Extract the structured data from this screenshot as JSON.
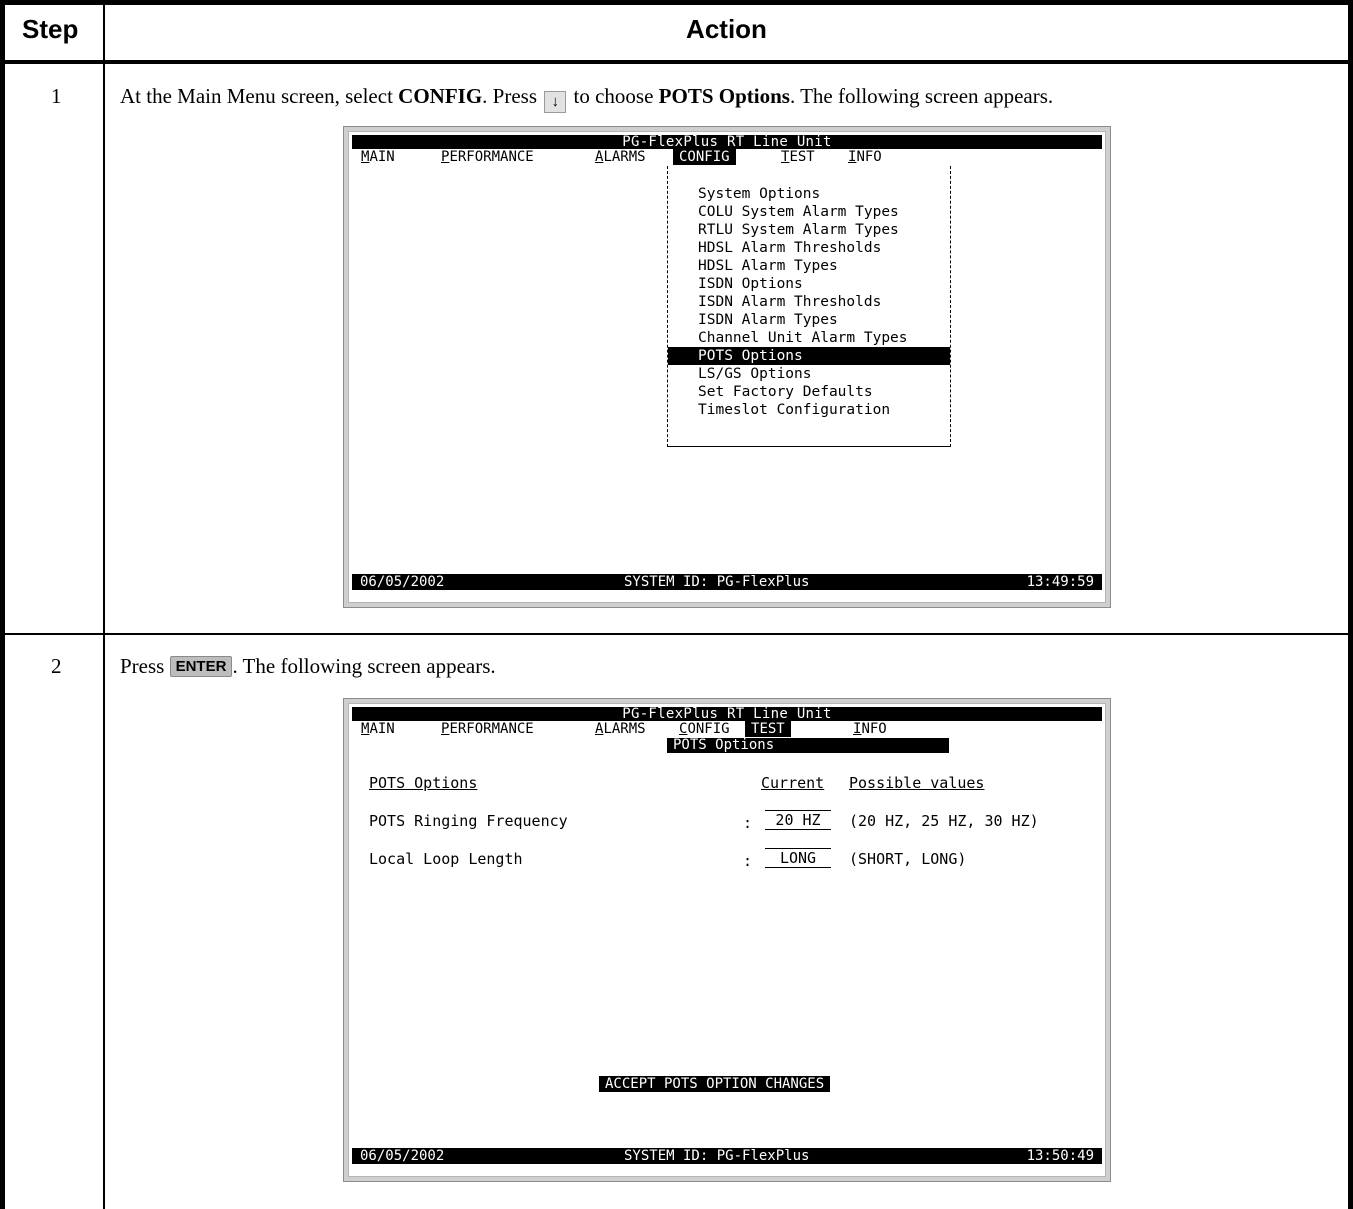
{
  "header": {
    "step": "Step",
    "action": "Action"
  },
  "steps": [
    {
      "number": "1",
      "instruction": {
        "p1": "At the Main Menu screen, select ",
        "b1": "CONFIG",
        "p2": ". Press ",
        "key": "↓",
        "p3": " to choose ",
        "b2": "POTS Options",
        "p4": ". The following screen appears."
      }
    },
    {
      "number": "2",
      "instruction": {
        "p1": "Press ",
        "key": "ENTER",
        "p2": ". The following screen appears."
      }
    }
  ],
  "screen1": {
    "title": "PG-FlexPlus RT Line Unit",
    "menu": [
      {
        "hot": "M",
        "rest": "AIN"
      },
      {
        "hot": "P",
        "rest": "ERFORMANCE"
      },
      {
        "hot": "A",
        "rest": "LARMS"
      },
      {
        "hot": "",
        "rest": "CONFIG"
      },
      {
        "hot": "T",
        "rest": "EST"
      },
      {
        "hot": "I",
        "rest": "NFO"
      }
    ],
    "dropdown": [
      "System Options",
      "COLU System Alarm Types",
      "RTLU System Alarm Types",
      "HDSL Alarm Thresholds",
      "HDSL Alarm Types",
      "ISDN Options",
      "ISDN Alarm Thresholds",
      "ISDN Alarm Types",
      "Channel Unit Alarm Types",
      "POTS Options",
      "LS/GS Options",
      "Set Factory Defaults",
      "Timeslot Configuration"
    ],
    "selected_item": "POTS Options",
    "status": {
      "date": "06/05/2002",
      "system": "SYSTEM ID: PG-FlexPlus",
      "time": "13:49:59"
    }
  },
  "screen2": {
    "title": "PG-FlexPlus RT Line Unit",
    "menu": [
      {
        "hot": "M",
        "rest": "AIN"
      },
      {
        "hot": "P",
        "rest": "ERFORMANCE"
      },
      {
        "hot": "A",
        "rest": "LARMS"
      },
      {
        "hot": "C",
        "rest": "ONFIG"
      },
      {
        "hot": "T",
        "rest": "EST"
      },
      {
        "hot": "I",
        "rest": "NFO"
      }
    ],
    "subtitle": "POTS Options",
    "col_options": "POTS Options",
    "col_current": "Current",
    "col_possible": "Possible values",
    "rows": [
      {
        "label": "POTS Ringing Frequency",
        "colon": ":",
        "current": "20 HZ",
        "possible": "(20 HZ, 25 HZ, 30 HZ)"
      },
      {
        "label": "Local Loop Length",
        "colon": ":",
        "current": "LONG",
        "possible": "(SHORT, LONG)"
      }
    ],
    "accept_button": "ACCEPT POTS OPTION CHANGES",
    "status": {
      "date": "06/05/2002",
      "system": "SYSTEM ID: PG-FlexPlus",
      "time": "13:50:49"
    }
  }
}
